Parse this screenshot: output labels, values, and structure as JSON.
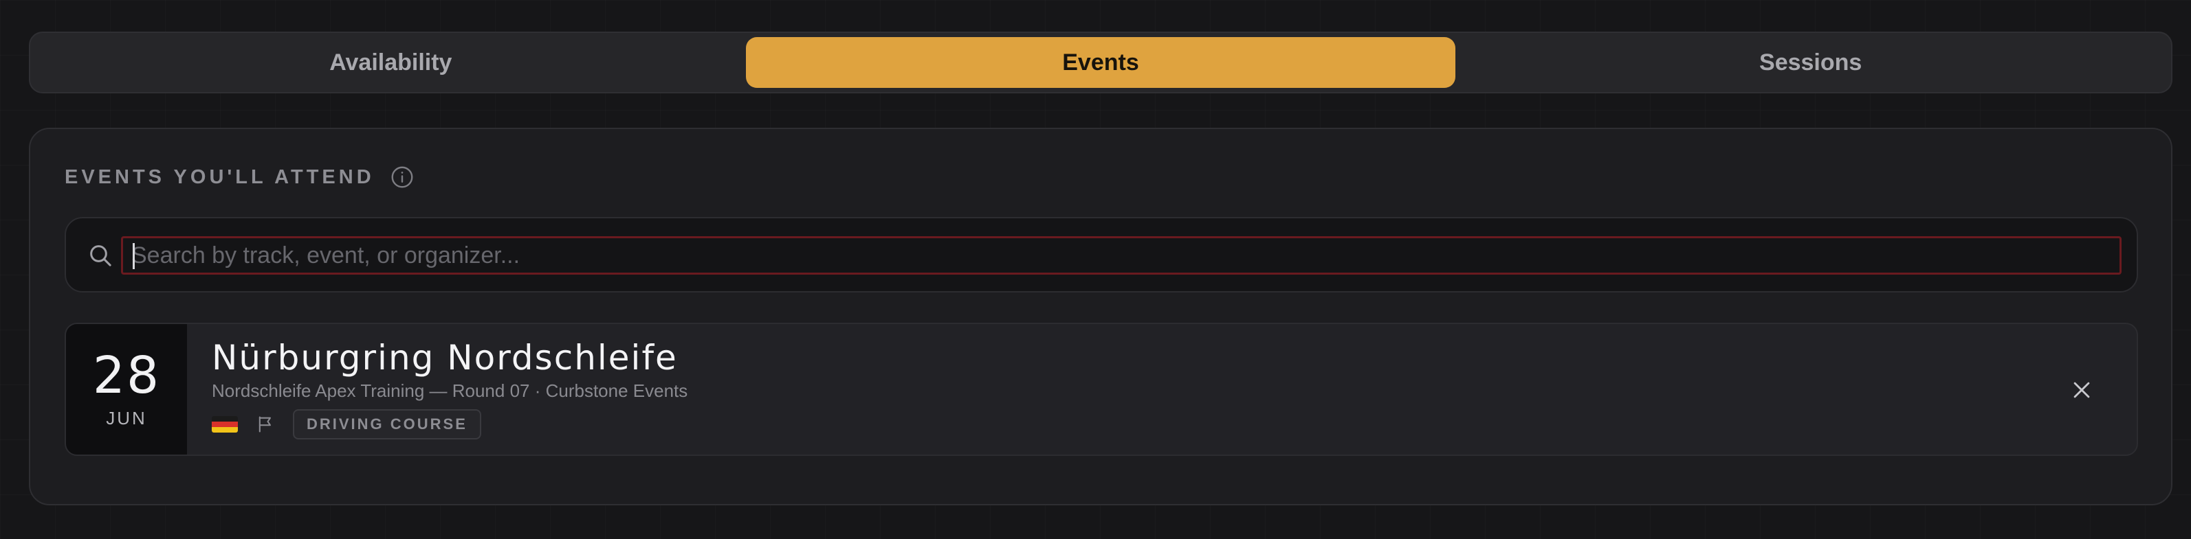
{
  "tabs": [
    {
      "label": "Availability",
      "active": false
    },
    {
      "label": "Events",
      "active": true
    },
    {
      "label": "Sessions",
      "active": false
    }
  ],
  "events_section": {
    "title": "EVENTS YOU'LL ATTEND",
    "search": {
      "placeholder": "Search by track, event, or organizer...",
      "value": ""
    },
    "events": [
      {
        "day": "28",
        "month": "JUN",
        "title": "Nürburgring Nordschleife",
        "subtitle": "Nordschleife Apex Training — Round 07 · Curbstone Events",
        "country_flag": "germany-flag",
        "type_icon": "flag-icon",
        "type_badge": "DRIVING COURSE"
      }
    ]
  },
  "colors": {
    "accent": "#dfa33f",
    "background": "#161618",
    "card": "#1d1d20",
    "search_focus_border": "#6a1a1f"
  }
}
